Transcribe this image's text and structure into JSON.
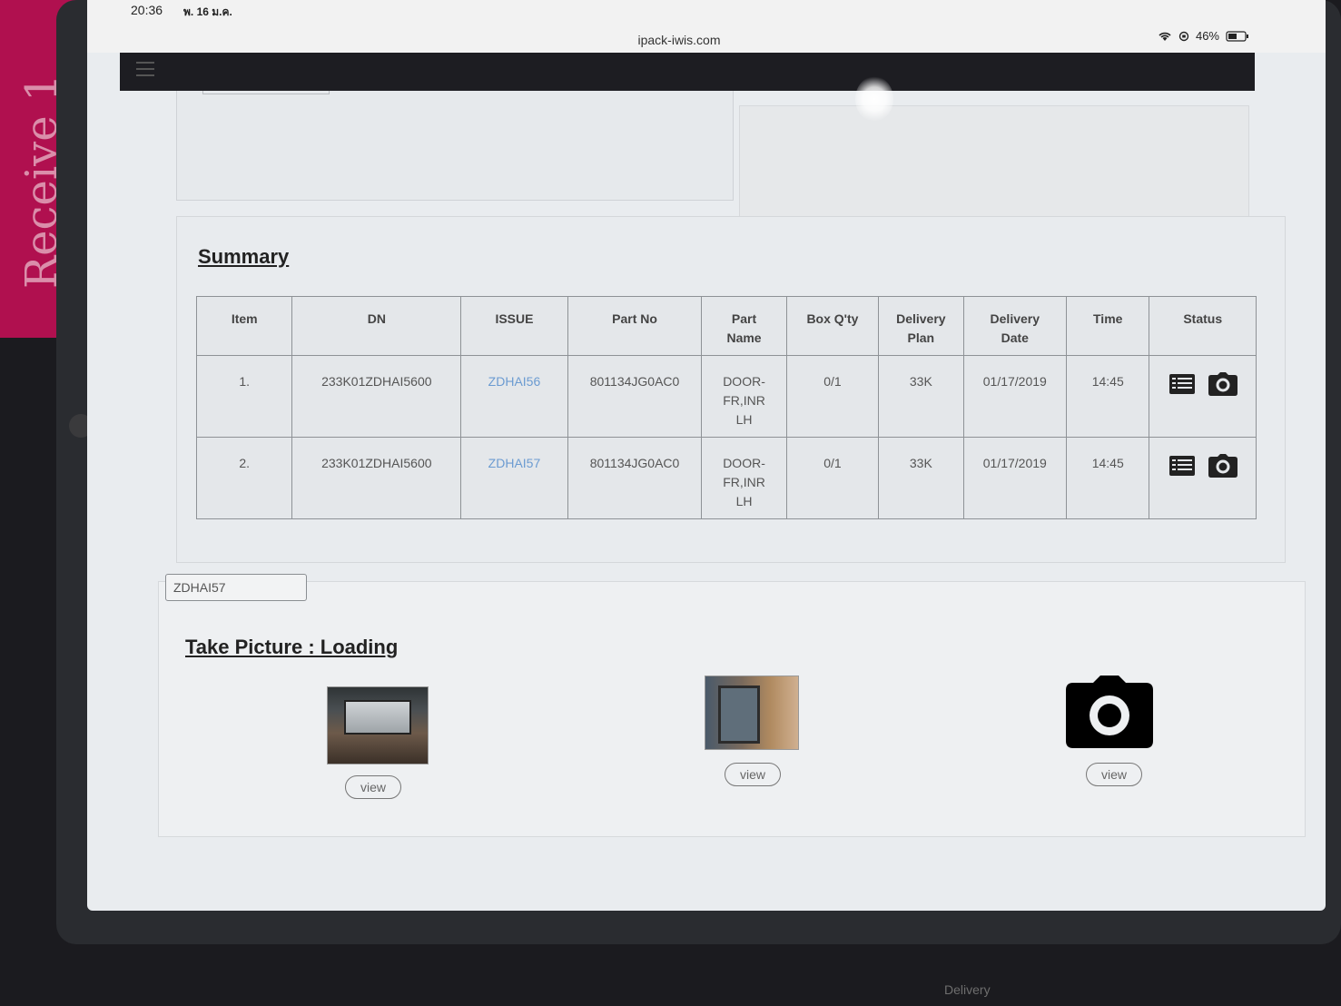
{
  "note": {
    "text": "Receive 1"
  },
  "statusbar": {
    "time": "20:36",
    "date": "พ. 16 ม.ค.",
    "battery": "46%"
  },
  "urlbar": {
    "url": "ipack-iwis.com"
  },
  "summary": {
    "title": "Summary",
    "columns": [
      "Item",
      "DN",
      "ISSUE",
      "Part No",
      "Part Name",
      "Box Q'ty",
      "Delivery Plan",
      "Delivery Date",
      "Time",
      "Status"
    ],
    "rows": [
      {
        "item": "1.",
        "dn": "233K01ZDHAI5600",
        "issue": "ZDHAI56",
        "part_no": "801134JG0AC0",
        "part_name": "DOOR-FR,INR LH",
        "box_qty": "0/1",
        "delivery_plan": "33K",
        "delivery_date": "01/17/2019",
        "time": "14:45"
      },
      {
        "item": "2.",
        "dn": "233K01ZDHAI5600",
        "issue": "ZDHAI57",
        "part_no": "801134JG0AC0",
        "part_name": "DOOR-FR,INR LH",
        "box_qty": "0/1",
        "delivery_plan": "33K",
        "delivery_date": "01/17/2019",
        "time": "14:45"
      }
    ]
  },
  "issue_input": {
    "value": "ZDHAI57"
  },
  "take_picture": {
    "title": "Take Picture : Loading",
    "view_labels": [
      "view",
      "view",
      "view"
    ]
  },
  "icons": {
    "status_list": "list-icon",
    "status_camera": "camera-icon",
    "empty_slot": "camera-icon"
  },
  "colors": {
    "issue_link": "#6b9bd1",
    "navbar": "#1d1d22"
  },
  "bottom_label": {
    "text": "Delivery"
  }
}
